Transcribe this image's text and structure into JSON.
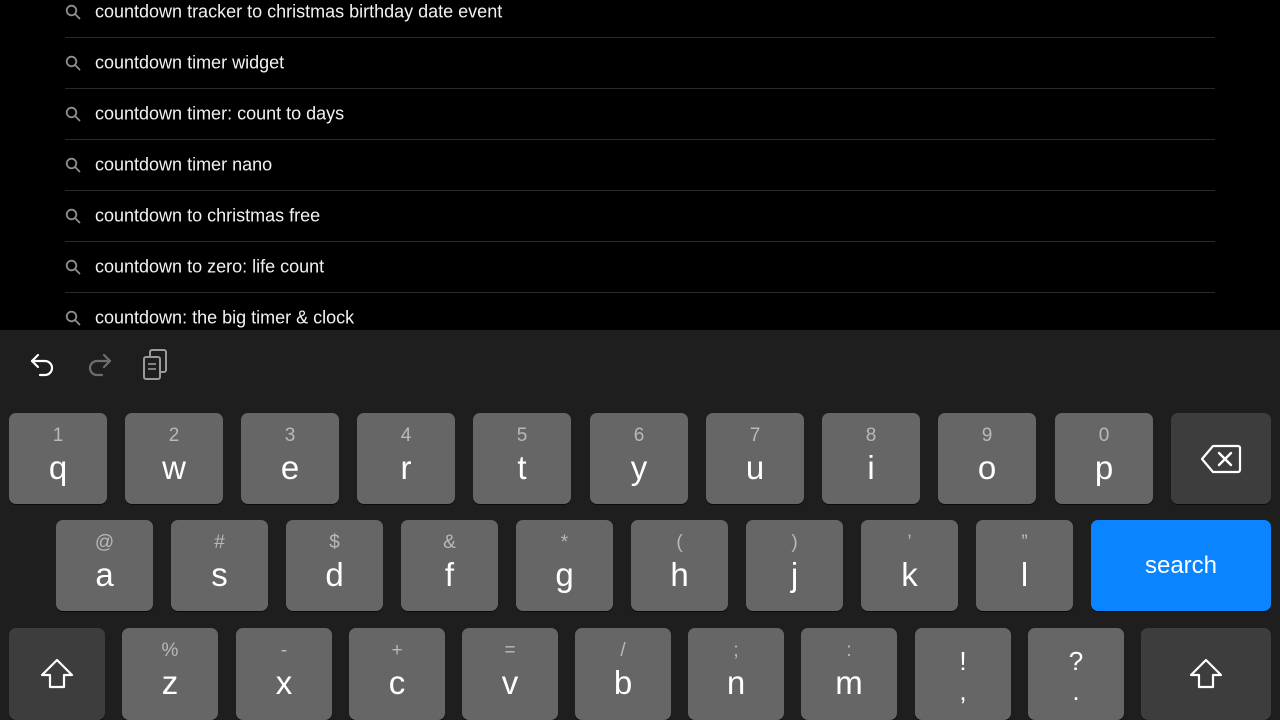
{
  "suggestions": [
    "countdown tracker to christmas birthday date event",
    "countdown timer widget",
    "countdown timer: count to days",
    "countdown timer nano",
    "countdown to christmas free",
    "countdown to zero: life count",
    "countdown: the big timer & clock"
  ],
  "icons": {
    "suggestion": "search-icon",
    "undo": "undo-icon",
    "redo": "redo-icon",
    "paste": "paste-icon",
    "backspace": "backspace-icon",
    "shift": "shift-icon"
  },
  "keyboard": {
    "row1": [
      {
        "pri": "q",
        "sec": "1"
      },
      {
        "pri": "w",
        "sec": "2"
      },
      {
        "pri": "e",
        "sec": "3"
      },
      {
        "pri": "r",
        "sec": "4"
      },
      {
        "pri": "t",
        "sec": "5"
      },
      {
        "pri": "y",
        "sec": "6"
      },
      {
        "pri": "u",
        "sec": "7"
      },
      {
        "pri": "i",
        "sec": "8"
      },
      {
        "pri": "o",
        "sec": "9"
      },
      {
        "pri": "p",
        "sec": "0"
      }
    ],
    "row2": [
      {
        "pri": "a",
        "sec": "@"
      },
      {
        "pri": "s",
        "sec": "#"
      },
      {
        "pri": "d",
        "sec": "$"
      },
      {
        "pri": "f",
        "sec": "&"
      },
      {
        "pri": "g",
        "sec": "*"
      },
      {
        "pri": "h",
        "sec": "("
      },
      {
        "pri": "j",
        "sec": ")"
      },
      {
        "pri": "k",
        "sec": "’"
      },
      {
        "pri": "l",
        "sec": "”"
      }
    ],
    "row3": [
      {
        "pri": "z",
        "sec": "%"
      },
      {
        "pri": "x",
        "sec": "-"
      },
      {
        "pri": "c",
        "sec": "+"
      },
      {
        "pri": "v",
        "sec": "="
      },
      {
        "pri": "b",
        "sec": "/"
      },
      {
        "pri": "n",
        "sec": ";"
      },
      {
        "pri": "m",
        "sec": ":"
      }
    ],
    "punct": [
      {
        "top": "!",
        "bot": ","
      },
      {
        "top": "?",
        "bot": "."
      }
    ],
    "search_label": "search"
  },
  "colors": {
    "key": "#666667",
    "key_dark": "#3d3d3e",
    "accent": "#0a84ff",
    "keyboard_bg": "#1e1e1e"
  }
}
